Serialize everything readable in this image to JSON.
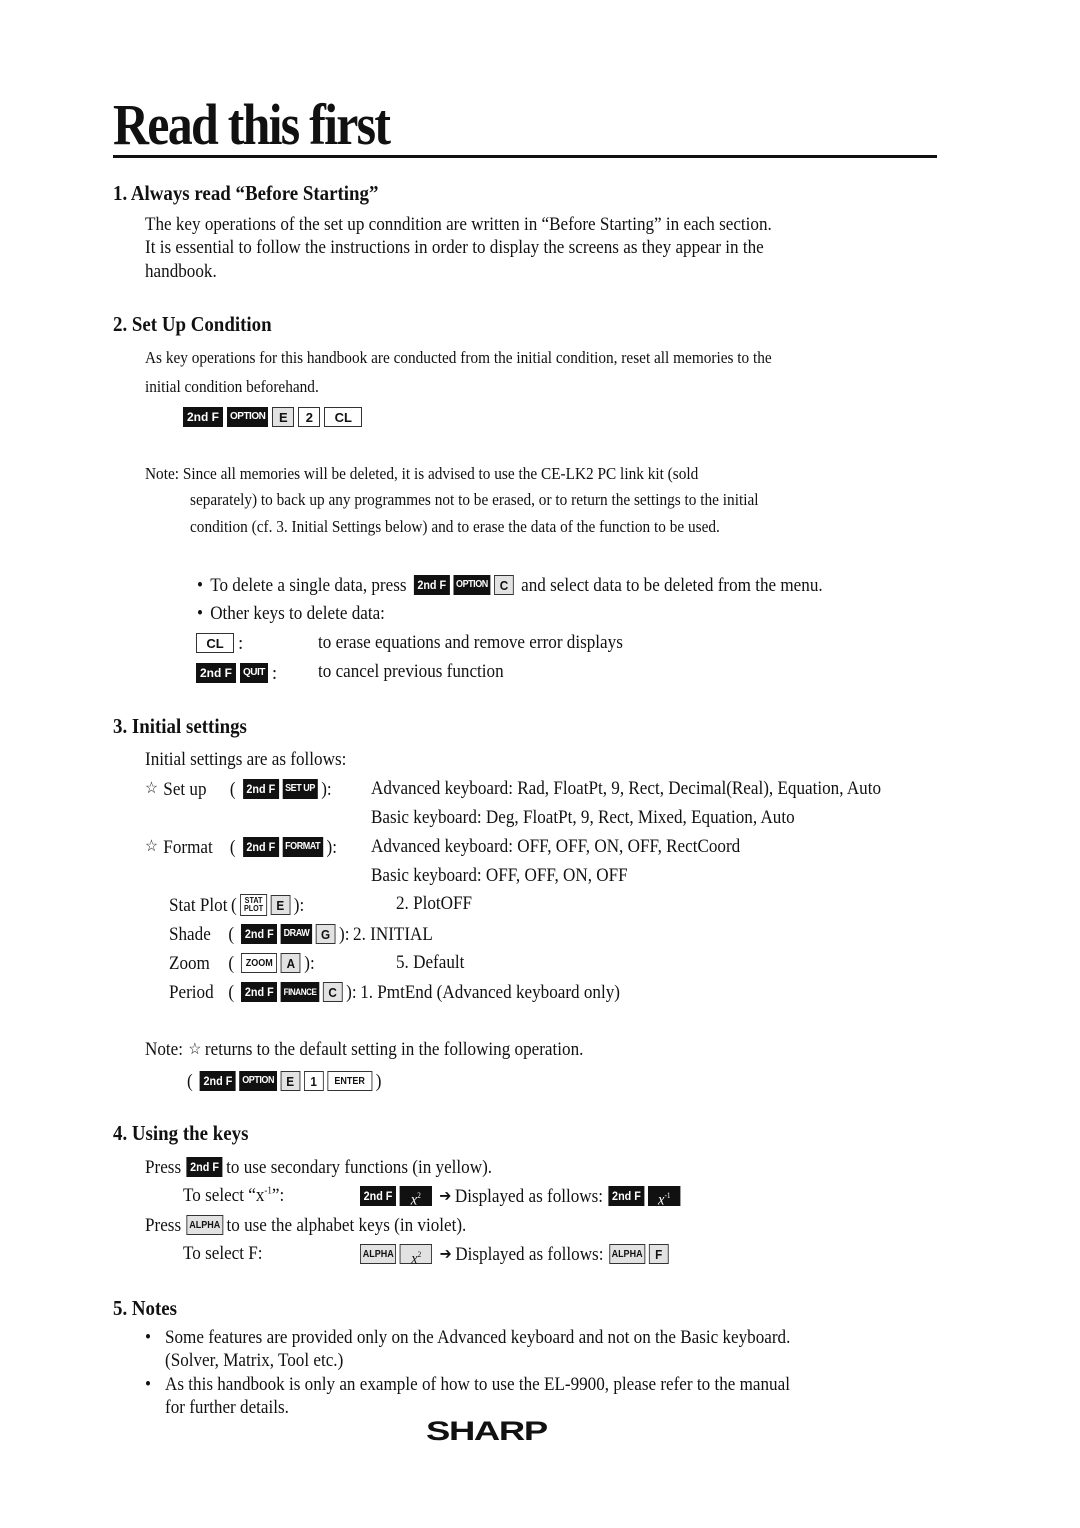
{
  "page": {
    "title": "Read this first",
    "sections": [
      {
        "heading": "1. Always read “Before Starting”",
        "lines": [
          "The key operations of the set up conndition are written in “Before Starting” in each section.",
          "It is essential to follow the instructions in order to display the screens as they appear in the",
          "handbook."
        ]
      },
      {
        "heading": "2. Set Up Condition",
        "lines": [
          "As key operations for this handbook are conducted from the initial condition, reset all memories to the",
          "initial condition beforehand."
        ],
        "reset_keys": [
          "2nd F",
          "OPTION",
          "E",
          "2",
          "CL"
        ],
        "note_lines": [
          "Note: Since all memories will be deleted, it is advised to use the CE-LK2 PC link kit (sold",
          "separately) to back up any programmes not to be erased, or to return the settings to the initial",
          "condition (cf. 3. Initial Settings below) and to erase the data of the function to be used."
        ],
        "bullet1_pre": "To delete a single data, press",
        "bullet1_keys": [
          "2nd F",
          "OPTION",
          "C"
        ],
        "bullet1_post": "and select data to be deleted from the menu.",
        "bullet2": "Other keys to delete data:",
        "delete_keys": [
          {
            "keys": [
              "CL"
            ],
            "desc": "to erase equations and remove error displays"
          },
          {
            "keys": [
              "2nd F",
              "QUIT"
            ],
            "desc": "to cancel previous function"
          }
        ]
      },
      {
        "heading": "3. Initial settings",
        "intro": "Initial settings are as follows:",
        "setup": {
          "label": "Set up",
          "keys": [
            "2nd F",
            "SET UP"
          ],
          "advanced": "Advanced keyboard: Rad, FloatPt, 9, Rect, Decimal(Real), Equation, Auto",
          "basic": "Basic keyboard: Deg, FloatPt, 9, Rect, Mixed, Equation, Auto"
        },
        "format": {
          "label": "Format",
          "keys": [
            "2nd F",
            "FORMAT"
          ],
          "advanced": "Advanced keyboard: OFF, OFF, ON, OFF, RectCoord",
          "basic": "Basic keyboard: OFF, OFF, ON, OFF"
        },
        "others": [
          {
            "label": "Stat Plot",
            "keys": [
              "STAT",
              "PLOT",
              "E"
            ],
            "value": "2. PlotOFF"
          },
          {
            "label": "Shade",
            "keys": [
              "2nd F",
              "DRAW",
              "G"
            ],
            "value": "2. INITIAL"
          },
          {
            "label": "Zoom",
            "keys": [
              "ZOOM",
              "A"
            ],
            "value": "5. Default"
          },
          {
            "label": "Period",
            "keys": [
              "2nd F",
              "FINANCE",
              "C"
            ],
            "value": "1. PmtEnd (Advanced keyboard only)"
          }
        ],
        "note": "returns to the default setting in the following operation.",
        "note_prefix": "Note:",
        "default_keys": [
          "2nd F",
          "OPTION",
          "E",
          "1",
          "ENTER"
        ]
      },
      {
        "heading": "4. Using the keys",
        "press": "Press",
        "line1_post": "to use secondary functions (in yellow).",
        "select1": "To select “x",
        "select1_sup": "-1",
        "select1_end": "”:",
        "displayed": "Displayed as follows:",
        "line2_post": "to use the alphabet keys (in violet).",
        "select2": "To select F:",
        "keys": {
          "second": "2nd F",
          "alpha": "ALPHA",
          "x": "x",
          "sq": "2",
          "inv": "-1",
          "f": "F"
        }
      },
      {
        "heading": "5. Notes",
        "bullets": [
          [
            "Some features are provided only on the Advanced keyboard and not on the Basic keyboard.",
            "(Solver, Matrix, Tool etc.)"
          ],
          [
            "As this handbook is only an example of how to use the EL-9900, please refer to the manual",
            "for further details."
          ]
        ]
      }
    ],
    "logo": "SHARP",
    "icons": {
      "star": "☆",
      "bullet": "•",
      "arrow": "➔"
    }
  }
}
